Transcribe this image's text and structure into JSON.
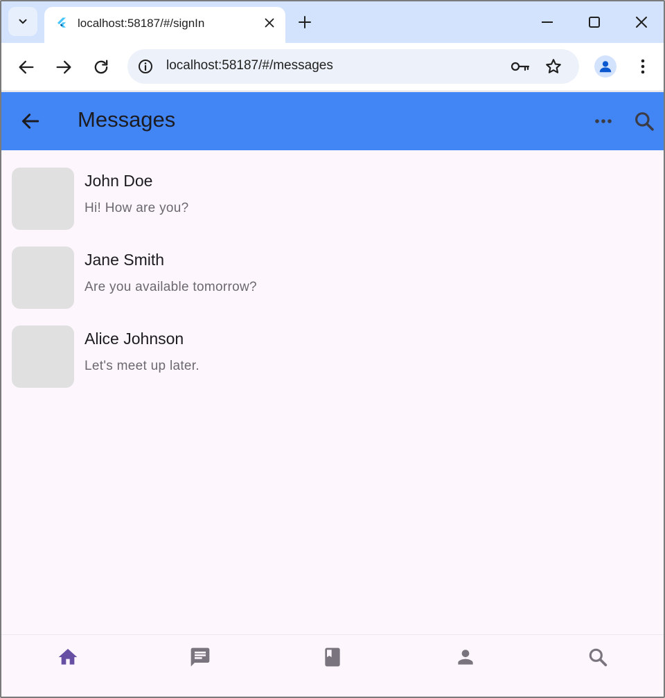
{
  "browser": {
    "tab_title": "localhost:58187/#/signIn",
    "url": "localhost:58187/#/messages"
  },
  "appbar": {
    "title": "Messages"
  },
  "messages": [
    {
      "name": "John Doe",
      "preview": "Hi! How are you?"
    },
    {
      "name": "Jane Smith",
      "preview": "Are you available tomorrow?"
    },
    {
      "name": "Alice Johnson",
      "preview": "Let's meet up later."
    }
  ],
  "bottom_nav": {
    "items": [
      "home-icon",
      "chat-icon",
      "book-icon",
      "person-icon",
      "search-icon"
    ],
    "active": "home-icon"
  },
  "colors": {
    "appbar": "#4285f4",
    "background": "#fdf6fd",
    "avatar_placeholder": "#e0e0e0",
    "nav_active": "#6750a4",
    "nav_inactive": "#79747e"
  }
}
